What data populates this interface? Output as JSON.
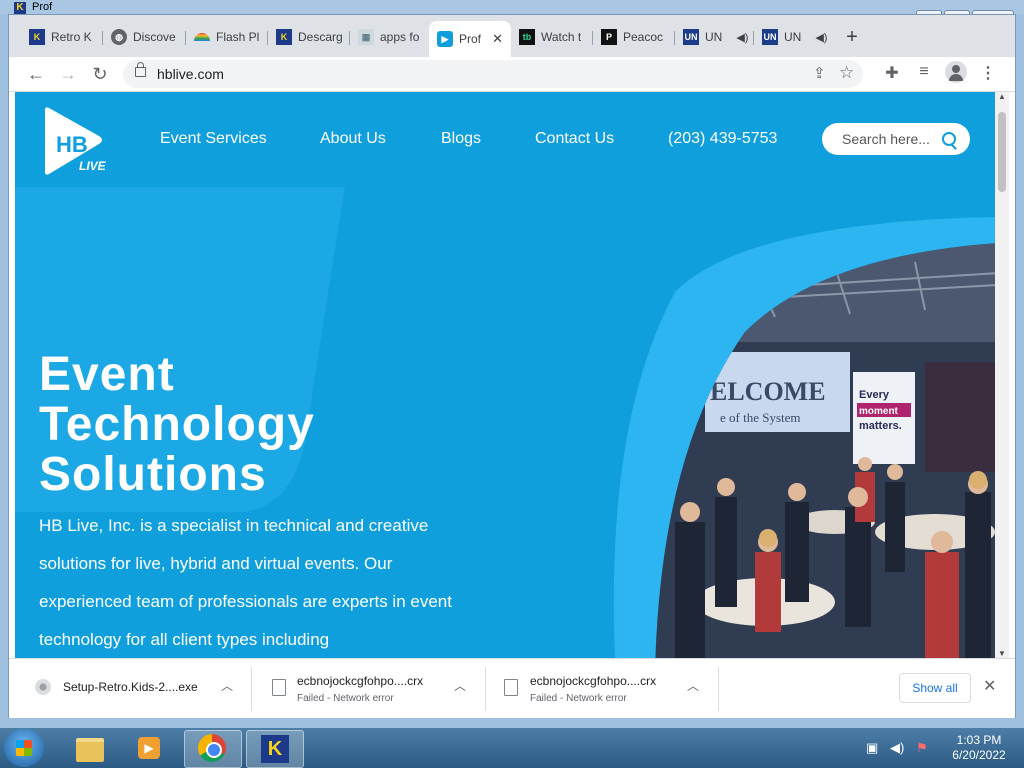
{
  "window": {
    "title": "Prof",
    "controls": {
      "minimize": "—",
      "maximize": "▢",
      "close": "✕"
    }
  },
  "tabs": [
    {
      "label": "Retro K",
      "icon": "retro-kids-icon"
    },
    {
      "label": "Discove",
      "icon": "globe-icon"
    },
    {
      "label": "Flash Pl",
      "icon": "rainbow-icon"
    },
    {
      "label": "Descarg",
      "icon": "retro-kids-icon"
    },
    {
      "label": "apps fo",
      "icon": "apps-icon"
    },
    {
      "label": "Prof",
      "icon": "hb-live-icon",
      "active": true
    },
    {
      "label": "Watch t",
      "icon": "tubi-icon"
    },
    {
      "label": "Peacoc",
      "icon": "peacock-icon"
    },
    {
      "label": "UN",
      "icon": "univision-icon",
      "audio": true
    },
    {
      "label": "UN",
      "icon": "univision-icon",
      "audio": true
    }
  ],
  "new_tab": "+",
  "address": {
    "url": "hblive.com"
  },
  "site": {
    "logo_text": "HB",
    "logo_sub": "LIVE",
    "nav": [
      "Event Services",
      "About Us",
      "Blogs",
      "Contact Us",
      "(203) 439-5753"
    ],
    "search_placeholder": "Search here...",
    "hero_title": [
      "Event",
      "Technology",
      "Solutions"
    ],
    "hero_text": "HB Live, Inc. is a specialist in technical and creative solutions for live, hybrid and virtual events. Our experienced team of professionals are experts in event technology for all client types including",
    "photo_screen_text": "ELCOME",
    "photo_screen_sub": "e of the System",
    "photo_banner": [
      "Every",
      "moment",
      "matters."
    ]
  },
  "downloads": [
    {
      "name": "Setup-Retro.Kids-2....exe",
      "status": ""
    },
    {
      "name": "ecbnojockcgfohpo....crx",
      "status": "Failed - Network error"
    },
    {
      "name": "ecbnojockcgfohpo....crx",
      "status": "Failed - Network error"
    }
  ],
  "download_actions": {
    "show_all": "Show all",
    "close": "✕"
  },
  "taskbar": {
    "time": "1:03 PM",
    "date": "6/20/2022"
  },
  "colors": {
    "brand": "#0f9fdc",
    "tab_strip": "#dee1e6",
    "taskbar": "#2b5b84"
  }
}
